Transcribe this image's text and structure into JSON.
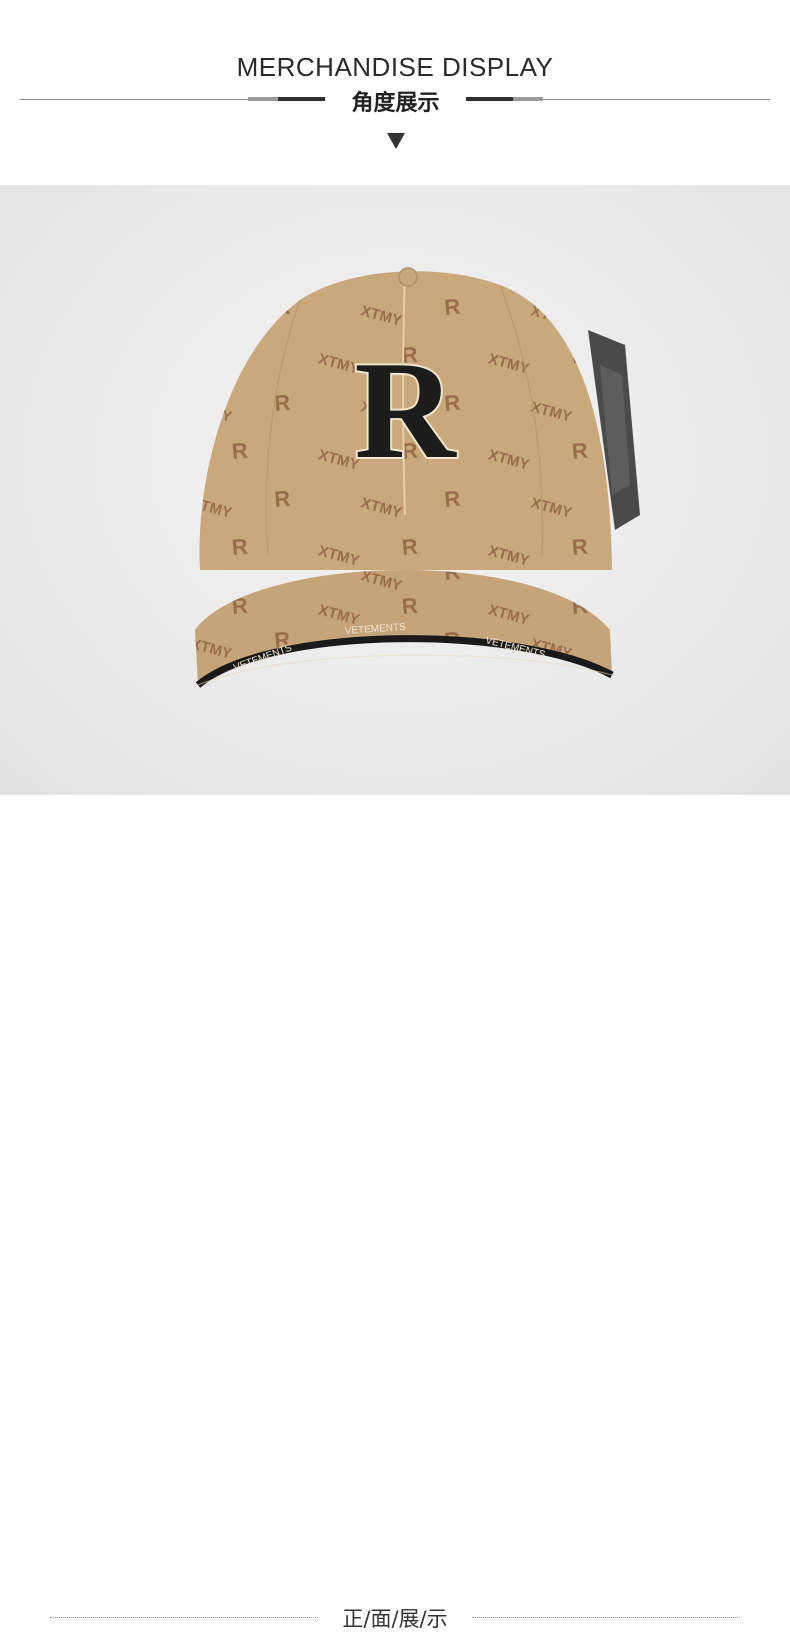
{
  "header": {
    "title_en": "MERCHANDISE DISPLAY",
    "title_cn": "角度展示"
  },
  "product": {
    "badge_letter": "R",
    "pattern_text": "XTMY",
    "pattern_letter": "R",
    "brim_tape_text": "VETEMENTS",
    "colors": {
      "cap": "#c9a87c",
      "pattern": "#8a5b3d",
      "badge": "#1c1c1c",
      "tag": "#4a4a4a"
    }
  },
  "footer": {
    "caption": "正/面/展/示"
  }
}
